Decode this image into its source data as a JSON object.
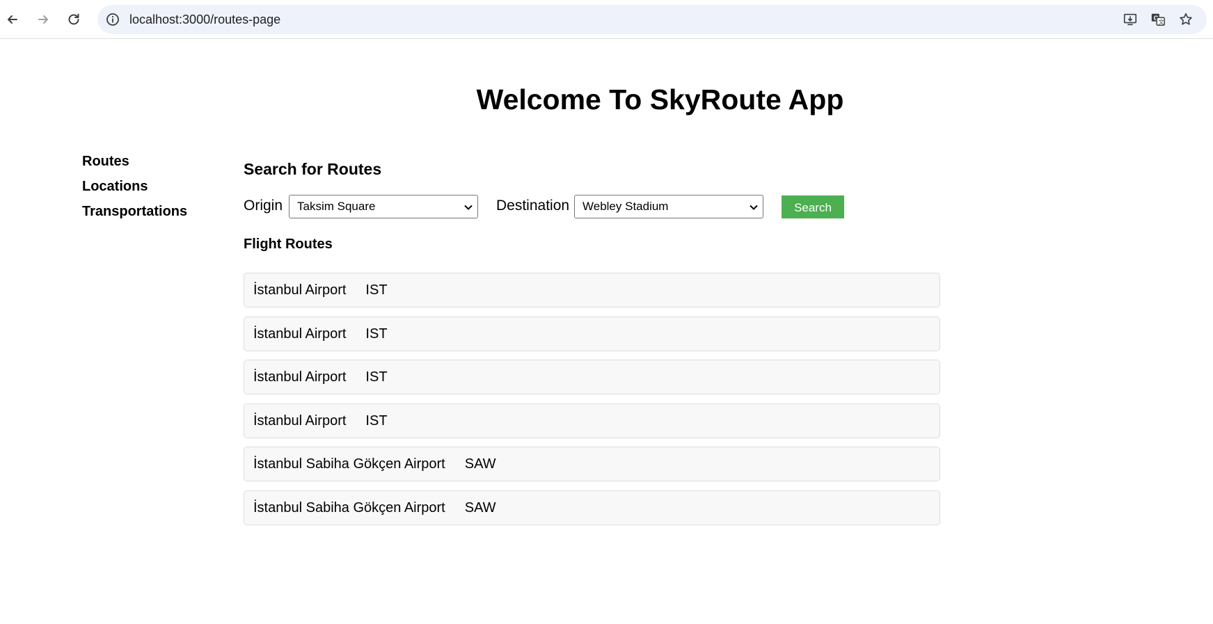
{
  "browser": {
    "url": "localhost:3000/routes-page",
    "icons": [
      "back-arrow-icon",
      "forward-arrow-icon",
      "reload-icon",
      "site-info-icon",
      "install-app-icon",
      "translate-icon",
      "bookmark-star-icon"
    ]
  },
  "page": {
    "title": "Welcome To SkyRoute App"
  },
  "sidebar": {
    "items": [
      {
        "label": "Routes"
      },
      {
        "label": "Locations"
      },
      {
        "label": "Transportations"
      }
    ]
  },
  "search": {
    "heading": "Search for Routes",
    "origin_label": "Origin",
    "origin_value": "Taksim Square",
    "destination_label": "Destination",
    "destination_value": "Webley Stadium",
    "button_label": "Search",
    "button_color": "#4caf50"
  },
  "results": {
    "heading": "Flight Routes",
    "routes": [
      {
        "name": "İstanbul Airport",
        "code": "IST"
      },
      {
        "name": "İstanbul Airport",
        "code": "IST"
      },
      {
        "name": "İstanbul Airport",
        "code": "IST"
      },
      {
        "name": "İstanbul Airport",
        "code": "IST"
      },
      {
        "name": "İstanbul Sabiha Gökçen Airport",
        "code": "SAW"
      },
      {
        "name": "İstanbul Sabiha Gökçen Airport",
        "code": "SAW"
      }
    ]
  }
}
